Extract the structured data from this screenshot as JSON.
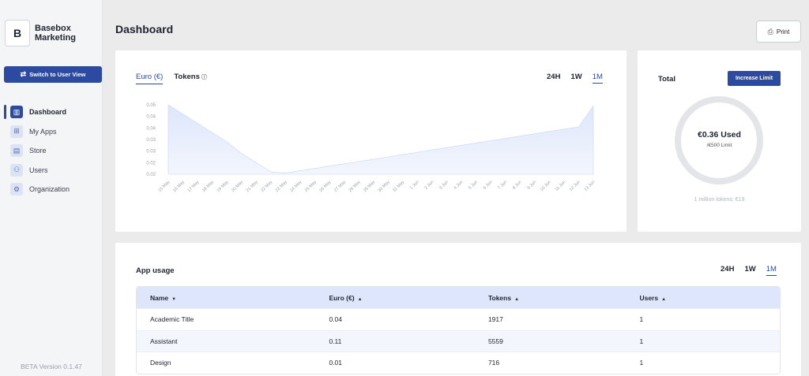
{
  "sidebar": {
    "logo_letter": "B",
    "org_name": "Basebox Marketing",
    "switch_label": "Switch to User View",
    "items": [
      {
        "label": "Dashboard",
        "icon": "chart-icon",
        "glyph": "▥",
        "active": true
      },
      {
        "label": "My Apps",
        "icon": "apps-icon",
        "glyph": "⊞",
        "active": false
      },
      {
        "label": "Store",
        "icon": "store-icon",
        "glyph": "▤",
        "active": false
      },
      {
        "label": "Users",
        "icon": "users-icon",
        "glyph": "⚇",
        "active": false
      },
      {
        "label": "Organization",
        "icon": "organization-icon",
        "glyph": "⚙",
        "active": false
      }
    ],
    "version": "BETA Version 0.1.47"
  },
  "header": {
    "title": "Dashboard",
    "print_label": "Print"
  },
  "chart_card": {
    "tab_euro": "Euro (€)",
    "tab_tokens": "Tokens",
    "ranges": [
      "24H",
      "1W",
      "1M"
    ],
    "active_range": "1M"
  },
  "chart_data": {
    "type": "area",
    "x": [
      "15 May",
      "16 May",
      "17 May",
      "18 May",
      "19 May",
      "20 May",
      "21 May",
      "22 May",
      "23 May",
      "24 May",
      "25 May",
      "26 May",
      "27 May",
      "28 May",
      "29 May",
      "30 May",
      "31 May",
      "1 Jun",
      "2 Jun",
      "3 Jun",
      "4 Jun",
      "5 Jun",
      "6 Jun",
      "7 Jun",
      "8 Jun",
      "9 Jun",
      "10 Jun",
      "11 Jun",
      "12 Jun",
      "13 Jun"
    ],
    "y_ticks": [
      "0.05",
      "0.04",
      "0.04",
      "0.03",
      "0.03",
      "0.02",
      "0.02"
    ],
    "series": [
      {
        "values": [
          0.05,
          0.046,
          0.042,
          0.038,
          0.034,
          0.029,
          0.025,
          0.021,
          0.0205,
          0.0215,
          0.0225,
          0.0235,
          0.0245,
          0.0255,
          0.0265,
          0.0275,
          0.0285,
          0.0295,
          0.0305,
          0.0315,
          0.0325,
          0.0335,
          0.0345,
          0.0355,
          0.0365,
          0.0375,
          0.0385,
          0.0395,
          0.0405,
          0.0495
        ]
      }
    ],
    "ylim": [
      0.02,
      0.05
    ],
    "colors": {
      "fill": "#dde6fb",
      "line": "#c8d5f5"
    }
  },
  "total_card": {
    "title": "Total",
    "increase_label": "Increase Limit",
    "used": "€0.36 Used",
    "limit": "/€500 Limit",
    "tokens_note": "1 million tokens: €19"
  },
  "usage": {
    "title": "App usage",
    "ranges": [
      "24H",
      "1W",
      "1M"
    ],
    "active_range": "1M",
    "columns": [
      "Name",
      "Euro (€)",
      "Tokens",
      "Users"
    ],
    "rows": [
      [
        "Academic Title",
        "0.04",
        "1917",
        "1"
      ],
      [
        "Assistant",
        "0.11",
        "5559",
        "1"
      ],
      [
        "Design",
        "0.01",
        "716",
        "1"
      ]
    ]
  }
}
